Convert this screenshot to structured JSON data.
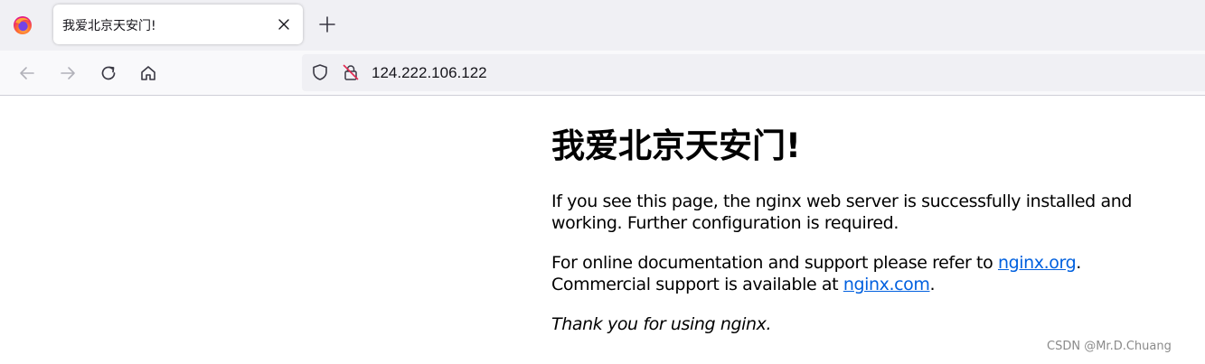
{
  "browser": {
    "tab": {
      "title": "我爱北京天安门!"
    },
    "url": "124.222.106.122",
    "icons": {
      "logo": "firefox-logo-icon",
      "tab_close": "close-icon",
      "new_tab": "plus-icon",
      "back": "arrow-left-icon",
      "forward": "arrow-right-icon",
      "reload": "reload-icon",
      "home": "home-icon",
      "tracking": "shield-icon",
      "security": "insecure-lock-icon"
    }
  },
  "page": {
    "heading": "我爱北京天安门!",
    "para1": "If you see this page, the nginx web server is successfully installed and working. Further configuration is required.",
    "para2_prefix": "For online documentation and support please refer to ",
    "link1": "nginx.org",
    "para2_mid": ".",
    "para2_line2": "Commercial support is available at ",
    "link2": "nginx.com",
    "para2_end": ".",
    "thanks": "Thank you for using nginx.",
    "link_color": "#0060df"
  },
  "watermark": "CSDN @Mr.D.Chuang"
}
